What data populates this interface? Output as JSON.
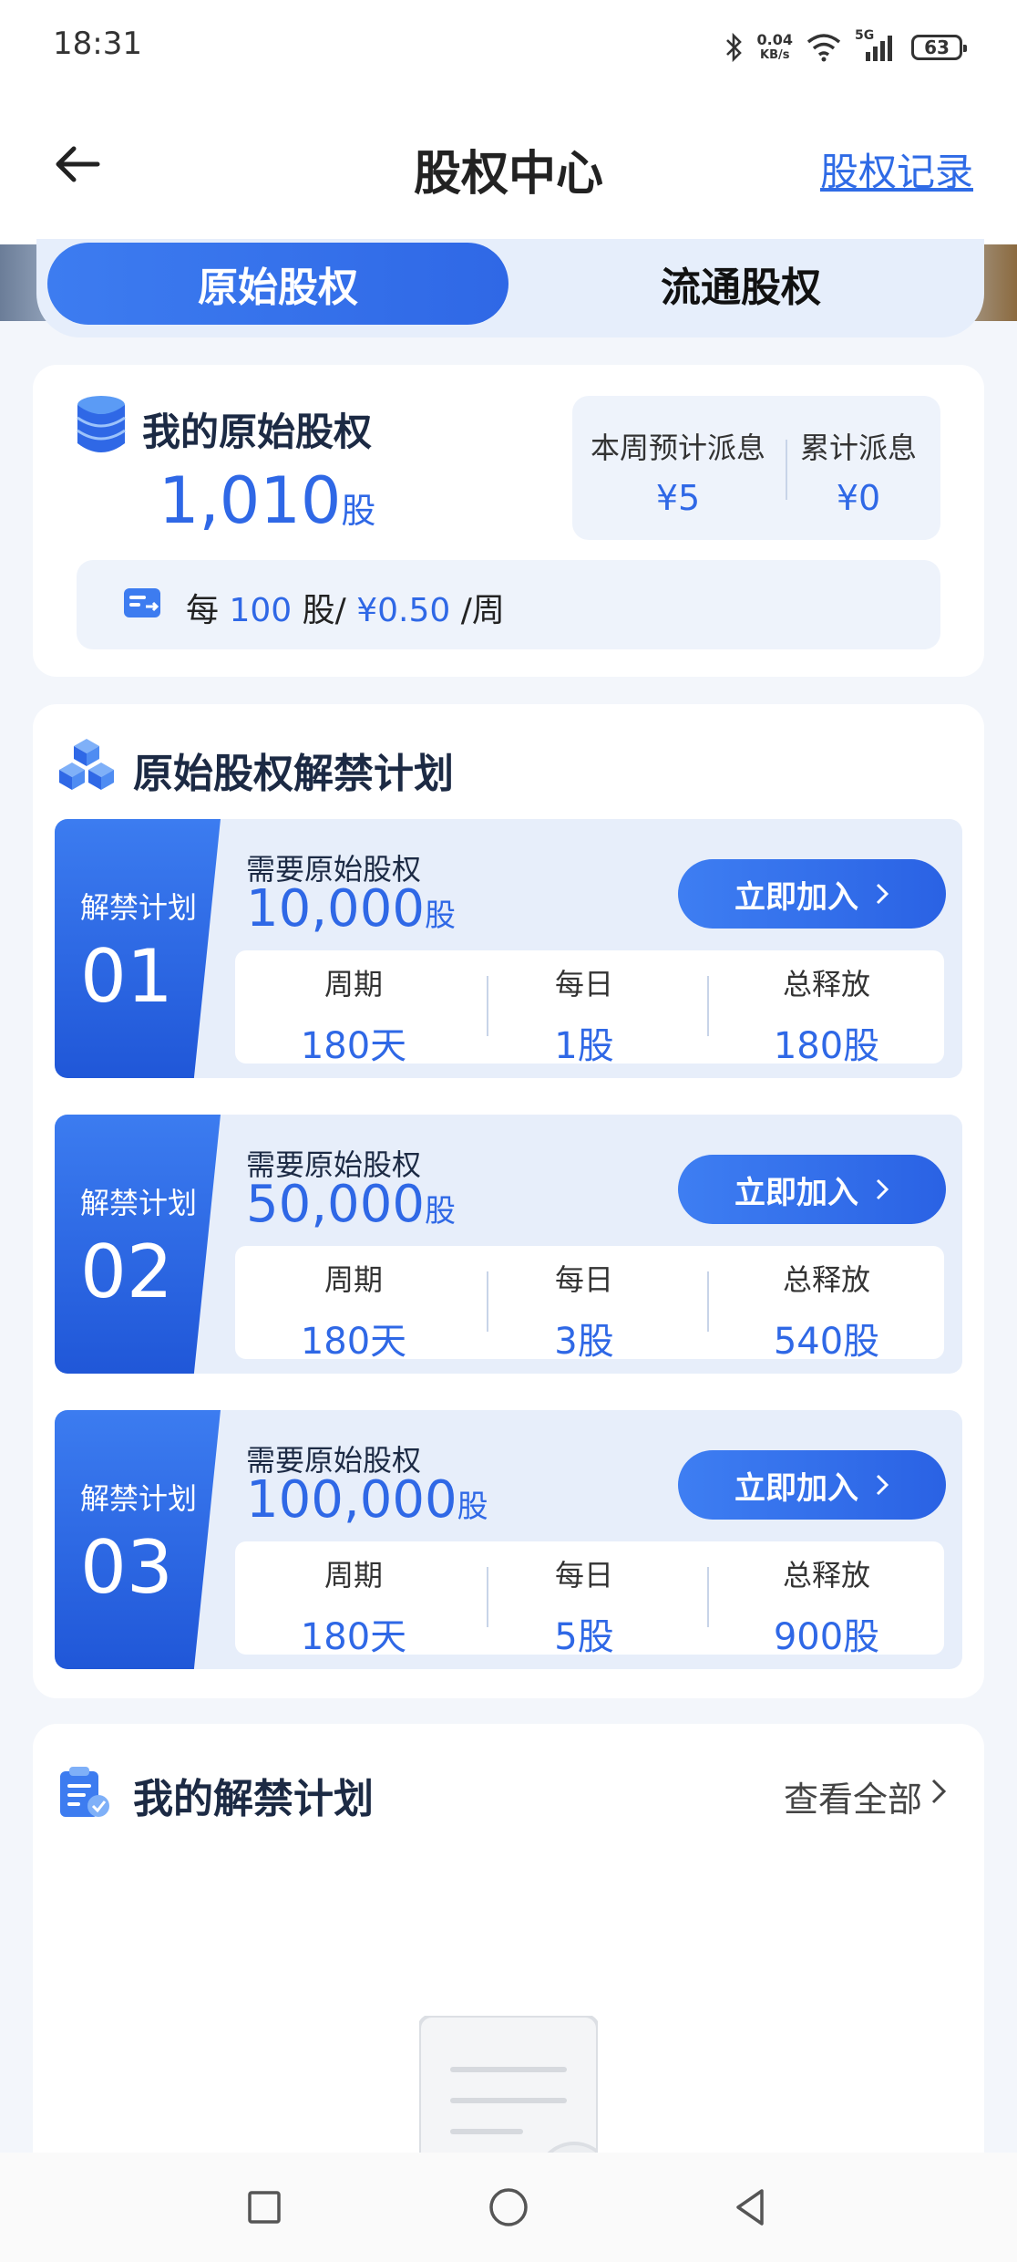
{
  "status_bar": {
    "time": "18:31",
    "net_speed": "0.04",
    "net_unit": "KB/s",
    "network": "5G",
    "battery": "63",
    "icons": [
      "bluetooth-icon",
      "wifi-icon",
      "signal-icon",
      "battery-icon"
    ]
  },
  "header": {
    "title": "股权中心",
    "record_link": "股权记录",
    "back_icon": "arrow-left-icon"
  },
  "tabs": [
    {
      "label": "原始股权",
      "active": true
    },
    {
      "label": "流通股权",
      "active": false
    }
  ],
  "my_equity": {
    "title": "我的原始股权",
    "amount": "1,010",
    "unit": "股",
    "weekly_label": "本周预计派息",
    "weekly_value": "¥5",
    "total_label": "累计派息",
    "total_value": "¥0",
    "rate": {
      "prefix": "每",
      "shares": "100",
      "unit_sep": "股/",
      "price": "¥0.50",
      "suffix": "/周"
    }
  },
  "plans": {
    "title": "原始股权解禁计划",
    "need_label": "需要原始股权",
    "tag_label": "解禁计划",
    "button_label": "立即加入",
    "stat_labels": {
      "period": "周期",
      "daily": "每日",
      "total": "总释放"
    },
    "unit": "股",
    "items": [
      {
        "num": "01",
        "amount": "10,000",
        "period": "180天",
        "daily": "1股",
        "total": "180股"
      },
      {
        "num": "02",
        "amount": "50,000",
        "period": "180天",
        "daily": "3股",
        "total": "540股"
      },
      {
        "num": "03",
        "amount": "100,000",
        "period": "180天",
        "daily": "5股",
        "total": "900股"
      }
    ]
  },
  "my_plans": {
    "title": "我的解禁计划",
    "view_all": "查看全部"
  },
  "colors": {
    "accent": "#2f68e6",
    "title_dark": "#1c2a44",
    "panel_bg": "#eef3fb",
    "page_bg": "#f3f6fb"
  }
}
